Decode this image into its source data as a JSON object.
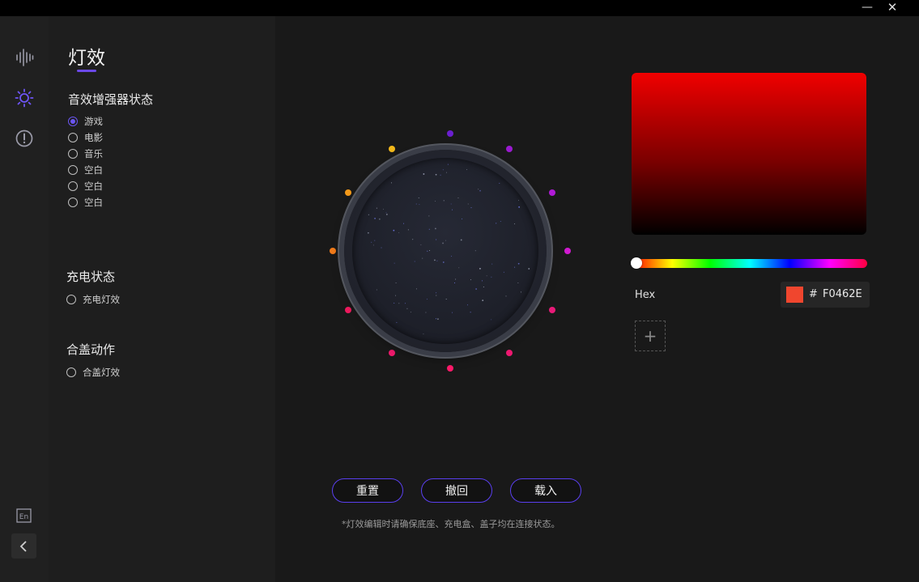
{
  "window": {
    "minimize": "—",
    "close": "✕"
  },
  "nav": [
    {
      "icon": "equalizer-icon"
    },
    {
      "icon": "light-effect-icon"
    },
    {
      "icon": "info-icon"
    }
  ],
  "bottom_nav": {
    "language_icon_text": "En",
    "collapse_icon": "chevron-left-icon"
  },
  "left_panel": {
    "title": "灯效",
    "sound_section": {
      "title": "音效增强器状态",
      "options": [
        {
          "label": "游戏",
          "selected": true
        },
        {
          "label": "电影",
          "selected": false
        },
        {
          "label": "音乐",
          "selected": false
        },
        {
          "label": "空白",
          "selected": false
        },
        {
          "label": "空白",
          "selected": false
        },
        {
          "label": "空白",
          "selected": false
        }
      ]
    },
    "charge_section": {
      "title": "充电状态",
      "options": [
        {
          "label": "充电灯效",
          "selected": false
        }
      ]
    },
    "lid_section": {
      "title": "合盖动作",
      "options": [
        {
          "label": "合盖灯效",
          "selected": false
        }
      ]
    }
  },
  "leds": [
    {
      "color": "#6b1fd0"
    },
    {
      "color": "#9a1ad0"
    },
    {
      "color": "#b01ad6"
    },
    {
      "color": "#d01ad0"
    },
    {
      "color": "#e81a78"
    },
    {
      "color": "#ee1870"
    },
    {
      "color": "#ff1a6a"
    },
    {
      "color": "#f01a6c"
    },
    {
      "color": "#f01a5e"
    },
    {
      "color": "#f07a1a"
    },
    {
      "color": "#f49a1a"
    },
    {
      "color": "#f4b81a"
    }
  ],
  "buttons": {
    "reset": "重置",
    "undo": "撤回",
    "load": "载入"
  },
  "note": "*灯效编辑时请确保底座、充电盒、盖子均在连接状态。",
  "color_picker": {
    "hex_label": "Hex",
    "hash": "#",
    "hex_value": "F0462E",
    "swatch_color": "#F0462E",
    "hue_position": 0,
    "add_symbol": "+"
  }
}
